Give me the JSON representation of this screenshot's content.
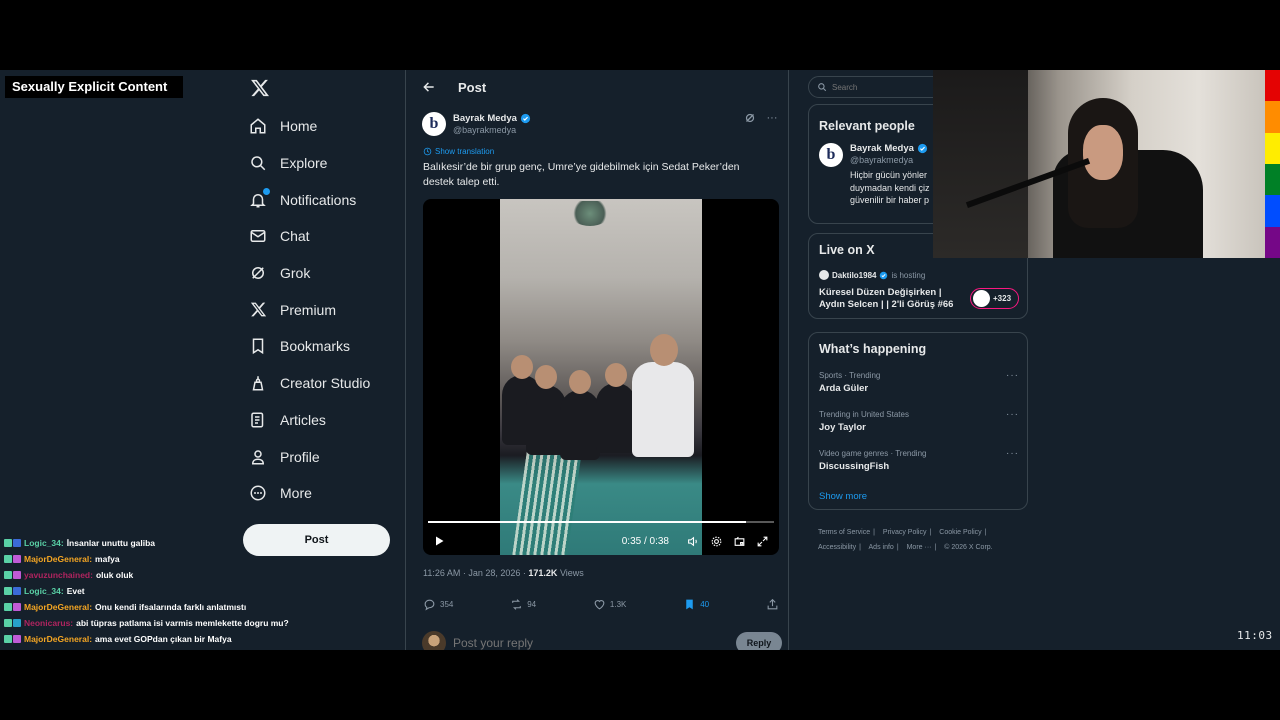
{
  "overlay": {
    "explicit_badge": "Sexually Explicit Content",
    "clock": "11:03"
  },
  "nav": {
    "items": [
      {
        "label": "Home",
        "icon": "home-icon"
      },
      {
        "label": "Explore",
        "icon": "search-icon"
      },
      {
        "label": "Notifications",
        "icon": "bell-icon"
      },
      {
        "label": "Chat",
        "icon": "mail-icon"
      },
      {
        "label": "Grok",
        "icon": "grok-icon"
      },
      {
        "label": "Premium",
        "icon": "x-logo-icon"
      },
      {
        "label": "Bookmarks",
        "icon": "bookmark-icon"
      },
      {
        "label": "Creator Studio",
        "icon": "creator-icon"
      },
      {
        "label": "Articles",
        "icon": "article-icon"
      },
      {
        "label": "Profile",
        "icon": "person-icon"
      },
      {
        "label": "More",
        "icon": "more-circle-icon"
      }
    ],
    "post_button": "Post"
  },
  "chat": [
    {
      "user": "Logic_34:",
      "color": "#5ad1a6",
      "badge": "#3b6bd8",
      "msg": "İnsanlar unuttu galiba"
    },
    {
      "user": "MajorDeGeneral:",
      "color": "#f5a623",
      "badge": "#c05bd6",
      "msg": "mafya"
    },
    {
      "user": "yavuzunchained:",
      "color": "#b0245f",
      "badge": "#c05bd6",
      "msg": "oluk oluk"
    },
    {
      "user": "Logic_34:",
      "color": "#5ad1a6",
      "badge": "#3b6bd8",
      "msg": "Evet"
    },
    {
      "user": "MajorDeGeneral:",
      "color": "#f5a623",
      "badge": "#c05bd6",
      "msg": "Onu kendi ifsalarında farklı anlatmıstı"
    },
    {
      "user": "Neonicarus:",
      "color": "#b0245f",
      "badge": "#27a1c9",
      "msg": "abi tüpras patlama isi varmis memlekette dogru mu?"
    },
    {
      "user": "MajorDeGeneral:",
      "color": "#f5a623",
      "badge": "#c05bd6",
      "msg": "ama evet GOPdan çıkan bir Mafya"
    }
  ],
  "main": {
    "header_title": "Post",
    "author": {
      "name": "Bayrak Medya",
      "handle": "@bayrakmedya",
      "avatar_letter": "b"
    },
    "show_translation": "Show translation",
    "text": "Balıkesir’de bir grup genç, Umre’ye gidebilmek için Sedat Peker’den destek talep etti.",
    "video": {
      "time": "0:35 / 0:38",
      "progress": 0.92
    },
    "meta": {
      "timestamp": "11:26 AM · Jan 28, 2026 · ",
      "views": "171.2K",
      "views_label": " Views"
    },
    "actions": {
      "replies": "354",
      "reposts": "94",
      "likes": "1.3K",
      "bookmarks": "40"
    },
    "reply_placeholder": "Post your reply",
    "reply_button": "Reply"
  },
  "right": {
    "search_placeholder": "Search",
    "relevant": {
      "title": "Relevant people",
      "name": "Bayrak Medya",
      "handle": "@bayrakmedya",
      "bio": "Hiçbir gücün yönler\nduymadan kendi çiz\ngüvenilir bir haber p"
    },
    "live": {
      "title": "Live on X",
      "host": "Daktilo1984",
      "host_status": "is hosting",
      "space_title": "Küresel Düzen Değişirken | Aydın Selcen |  | 2'li Görüş #66",
      "count": "+323"
    },
    "happening": {
      "title": "What’s happening",
      "trends": [
        {
          "meta": "Sports · Trending",
          "name": "Arda Güler"
        },
        {
          "meta": "Trending in United States",
          "name": "Joy Taylor"
        },
        {
          "meta": "Video game genres · Trending",
          "name": "DiscussingFish"
        }
      ],
      "show_more": "Show more"
    },
    "footer": {
      "links": [
        "Terms of Service",
        "Privacy Policy",
        "Cookie Policy",
        "Accessibility",
        "Ads info",
        "More ···"
      ],
      "copyright": "© 2026 X Corp."
    }
  },
  "colors": {
    "accent": "#1d9bf0",
    "background": "#15202b",
    "live": "#f91880"
  }
}
